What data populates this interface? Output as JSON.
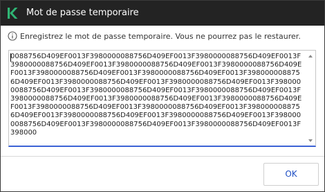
{
  "window": {
    "title": "Mot de passe temporaire",
    "logo_icon": "kaspersky-k-logo",
    "colors": {
      "titlebar": "#232323",
      "logo": "#2fb574",
      "accent": "#3c63d6"
    }
  },
  "info": {
    "icon": "info-circle-icon",
    "text": "Enregistrez le mot de passe temporaire. Vous ne pourrez pas le restaurer."
  },
  "password_field": {
    "value": "0088756D409EF0013F3980000088756D409EF0013F3980000088756D409EF0013F3980000088756D409EF0013F3980000088756D409EF0013F3980000088756D409EF0013F3980000088756D409EF0013F3980000088756D409EF0013F3980000088756D409EF0013F3980000088756D409EF0013F3980000088756D409EF0013F3980000088756D409EF0013F3980000088756D409EF0013F3980000088756D409EF0013F3980000088756D409EF0013F3980000088756D409EF0013F3980000088756D409EF0013F3980000088756D409EF0013F3980000088756D409EF0013F3980000088756D409EF0013F3980000088756D409EF0013F3980000088756D409EF0013F3980000088756D409EF0013F3980000088756D409EF0013F3980000088756D409EF0013F398000"
  },
  "buttons": {
    "ok_label": "OK"
  }
}
